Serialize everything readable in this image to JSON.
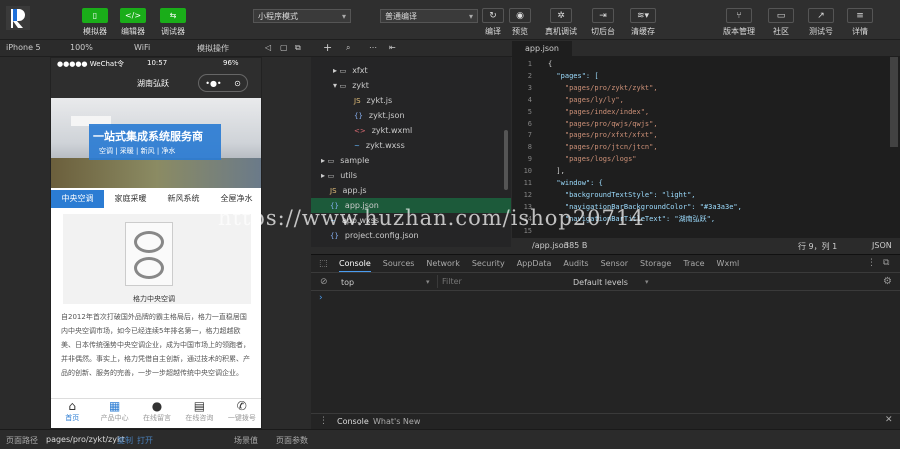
{
  "toolbar": {
    "simulator": "模拟器",
    "editor": "编辑器",
    "debugger": "调试器",
    "mode": "小程序模式",
    "compile_mode": "普通编译",
    "compile": "编译",
    "preview": "预览",
    "real_debug": "真机调试",
    "background": "切后台",
    "clear_cache": "清缓存",
    "version": "版本管理",
    "community": "社区",
    "test_account": "测试号",
    "details": "详情"
  },
  "sim_bar": {
    "device": "iPhone 5",
    "zoom": "100%",
    "network": "WiFi",
    "simulate": "模拟操作"
  },
  "phone": {
    "status_left": "●●●●● WeChat令",
    "status_time": "10:57",
    "status_right": "96%",
    "nav_title": "湖南弘跃",
    "banner_title": "一站式集成系统服务商",
    "banner_sub": "空调 | 采暖 | 新风 | 净水",
    "tabs": [
      "中央空调",
      "家庭采暖",
      "新风系统",
      "全屋净水"
    ],
    "product_label": "格力中央空调",
    "desc": "自2012年首次打破国外品牌的霸主格局后，格力一直稳居国内中央空调市场，如今已经连续5年排名第一，格力超越欧美、日本传统强势中央空调企业，成为中国市场上的领跑者，并非偶然。事实上，格力凭借自主创新，通过技术的积累、产品的创新、服务的完善，一步一步超越传统中央空调企业。",
    "bottom_nav": [
      "首页",
      "产品中心",
      "在线留言",
      "在线咨询",
      "一键拨号"
    ]
  },
  "explorer": {
    "items": [
      {
        "label": "xfxt",
        "indent": 1,
        "type": "folder",
        "arrow": "▸"
      },
      {
        "label": "zykt",
        "indent": 1,
        "type": "folder",
        "arrow": "▾"
      },
      {
        "label": "zykt.js",
        "indent": 2,
        "type": "js"
      },
      {
        "label": "zykt.json",
        "indent": 2,
        "type": "json"
      },
      {
        "label": "zykt.wxml",
        "indent": 2,
        "type": "wxml"
      },
      {
        "label": "zykt.wxss",
        "indent": 2,
        "type": "wxss"
      },
      {
        "label": "sample",
        "indent": 0,
        "type": "folder",
        "arrow": "▸"
      },
      {
        "label": "utils",
        "indent": 0,
        "type": "folder",
        "arrow": "▸"
      },
      {
        "label": "app.js",
        "indent": 0,
        "type": "js"
      },
      {
        "label": "app.json",
        "indent": 0,
        "type": "json",
        "selected": true
      },
      {
        "label": "app.wxss",
        "indent": 0,
        "type": "wxss"
      },
      {
        "label": "project.config.json",
        "indent": 0,
        "type": "json"
      }
    ]
  },
  "editor": {
    "tab": "app.json",
    "lines": [
      "{",
      "  \"pages\": [",
      "    \"pages/pro/zykt/zykt\",",
      "    \"pages/ly/ly\",",
      "    \"pages/index/index\",",
      "    \"pages/pro/qwjs/qwjs\",",
      "    \"pages/pro/xfxt/xfxt\",",
      "    \"pages/pro/jtcn/jtcn\",",
      "    \"pages/logs/logs\"",
      "",
      "  ],",
      "  \"window\": {",
      "    \"backgroundTextStyle\": \"light\",",
      "    \"navigationBarBackgroundColor\": \"#3a3a3e\",",
      "    \"navigationBarTitleText\": \"湖南弘跃\","
    ],
    "status_path": "/app.json",
    "status_size": "385 B",
    "status_pos": "行 9，列 1",
    "status_lang": "JSON"
  },
  "devtools": {
    "tabs": [
      "Console",
      "Sources",
      "Network",
      "Security",
      "AppData",
      "Audits",
      "Sensor",
      "Storage",
      "Trace",
      "Wxml"
    ],
    "context": "top",
    "filter_placeholder": "Filter",
    "levels": "Default levels",
    "drawer_tabs": [
      "Console",
      "What's New"
    ]
  },
  "footer": {
    "path_label": "页面路径",
    "path": "pages/pro/zykt/zykt",
    "copy": "复制",
    "open": "打开",
    "scene": "场景值",
    "params": "页面参数"
  },
  "watermark": "https://www.huzhan.com/ishop20714"
}
